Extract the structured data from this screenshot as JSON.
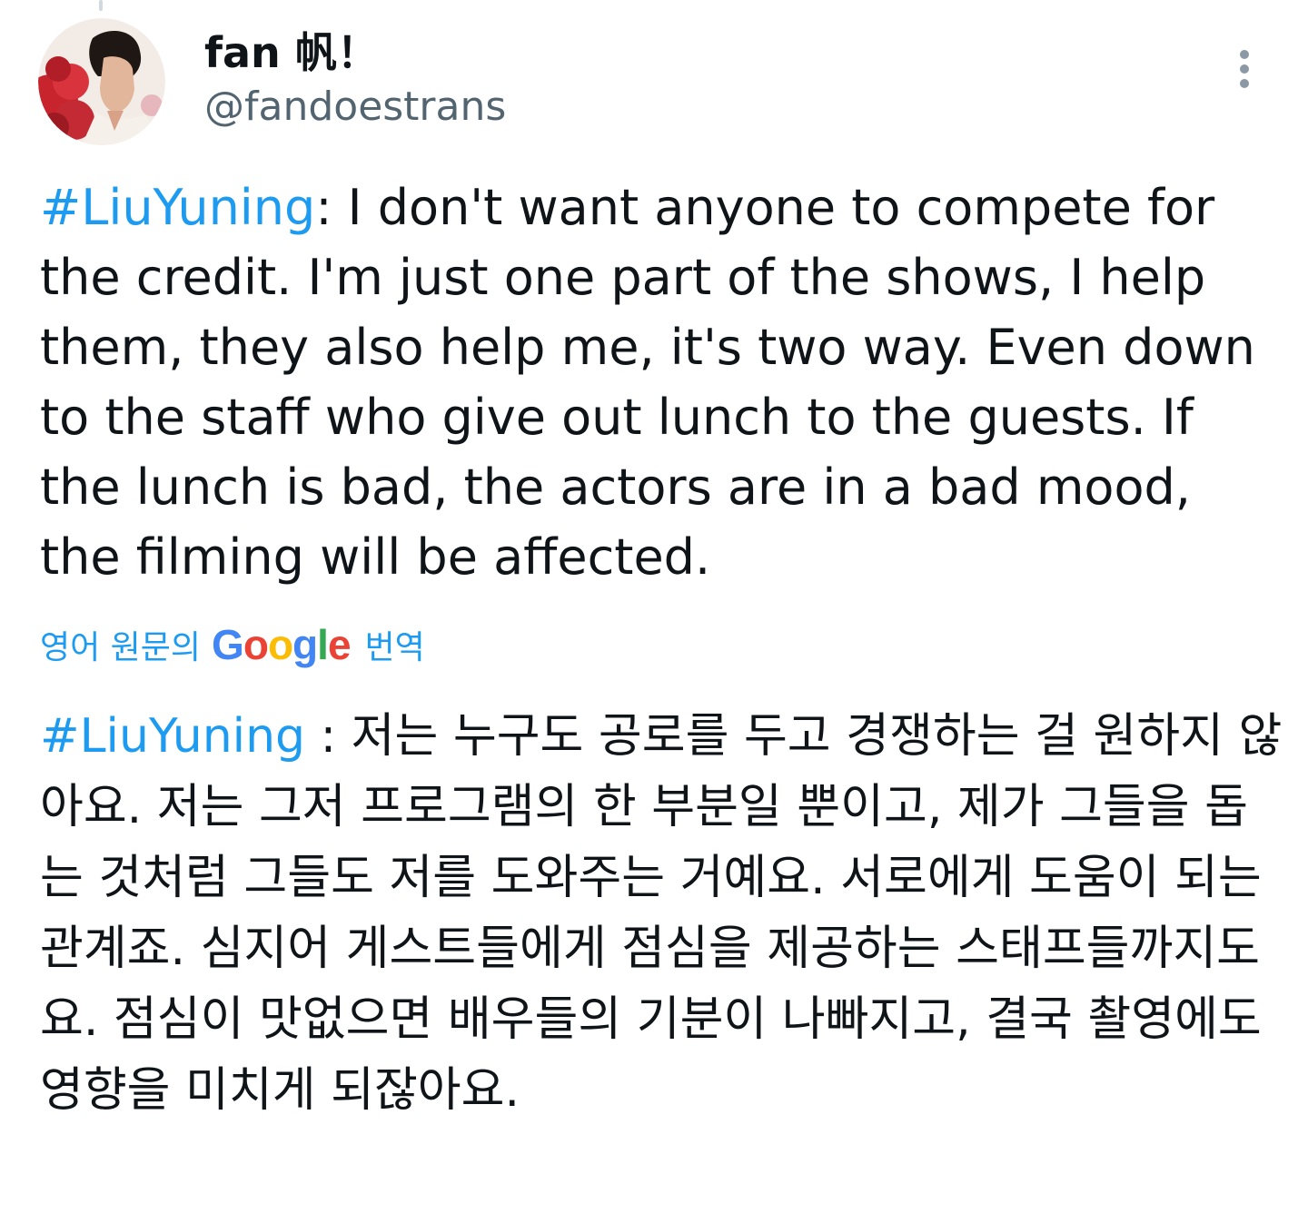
{
  "tweet": {
    "author": {
      "display_name": "fan 帆！",
      "handle": "@fandoestrans",
      "avatar_icon": "profile-photo"
    },
    "more_icon": "more-vertical-icon",
    "hashtag": "#LiuYuning",
    "text": ": I don't want anyone to compete for the credit. I'm just one part of the shows, I help them, they also help me, it's two way. Even down to the staff who give out lunch to the guests. If the lunch is bad, the actors are in a bad mood, the filming will be affected.",
    "translate": {
      "prefix": "영어 원문의",
      "brand": "Google",
      "suffix": "번역"
    },
    "translation": {
      "hashtag": "#LiuYuning",
      "text": " : 저는 누구도 공로를 두고 경쟁하는 걸 원하지 않아요. 저는 그저 프로그램의 한 부분일 뿐이고, 제가 그들을 돕는 것처럼 그들도 저를 도와주는 거예요. 서로에게 도움이 되는 관계죠. 심지어 게스트들에게 점심을 제공하는 스태프들까지도요. 점심이 맛없으면 배우들의 기분이 나빠지고, 결국 촬영에도 영향을 미치게 되잖아요."
    },
    "colors": {
      "link": "#1d9bf0",
      "text": "#0f1419",
      "secondary": "#536471"
    }
  }
}
